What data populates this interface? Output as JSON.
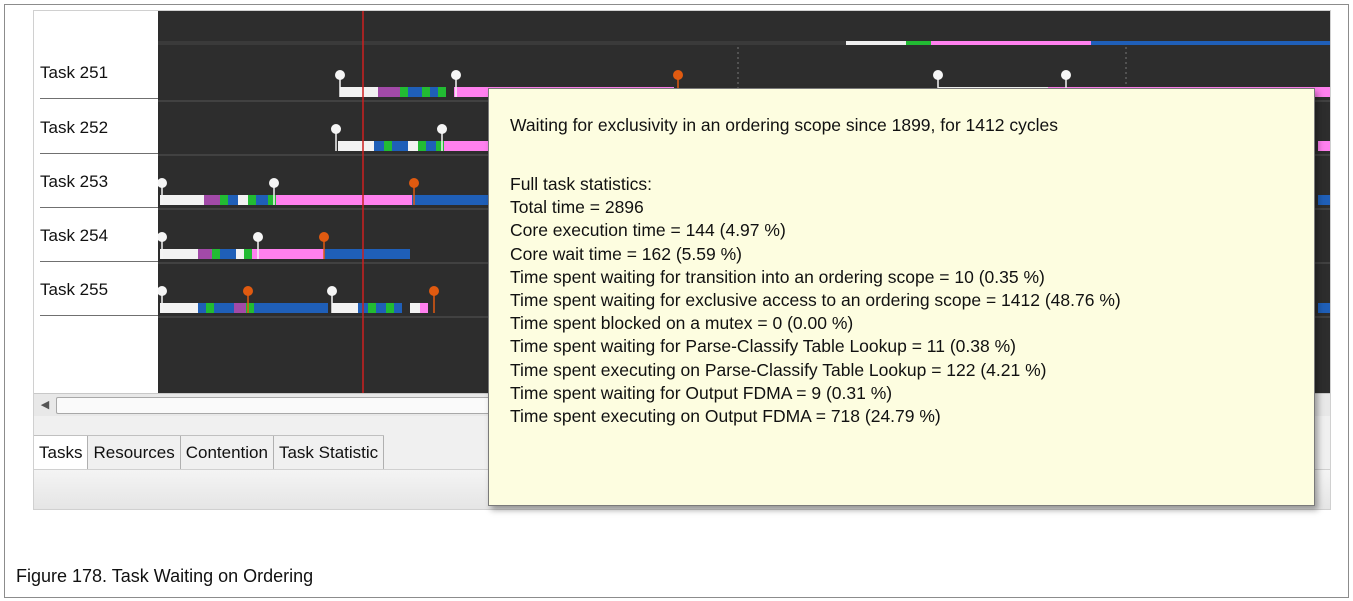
{
  "rows": [
    {
      "label": "Task 251"
    },
    {
      "label": "Task 252"
    },
    {
      "label": "Task 253"
    },
    {
      "label": "Task 254"
    },
    {
      "label": "Task 255"
    }
  ],
  "tabs": [
    "Tasks",
    "Resources",
    "Contention",
    "Task Statistic"
  ],
  "tooltip": {
    "header": "Waiting for exclusivity in an ordering scope since 1899, for 1412 cycles",
    "lines": [
      "Full task statistics:",
      "Total time = 2896",
      "Core execution time = 144 (4.97 %)",
      "Core wait time = 162 (5.59 %)",
      "Time spent waiting for transition into an ordering scope = 10 (0.35 %)",
      "Time spent waiting for exclusive access to an ordering scope = 1412 (48.76 %)",
      "Time spent blocked on a mutex = 0 (0.00 %)",
      "Time spent waiting for Parse-Classify Table Lookup = 11 (0.38 %)",
      "Time spent executing on Parse-Classify Table Lookup = 122 (4.21 %)",
      "Time spent waiting for Output FDMA = 9 (0.31 %)",
      "Time spent executing on Output FDMA = 718 (24.79 %)"
    ]
  },
  "caption": "Figure 178.  Task Waiting on Ordering",
  "colors": {
    "chart_bg": "#2d2d2d",
    "segment_white": "#f2f2f2",
    "segment_magenta": "#ff80ee",
    "segment_blue": "#1f5fb8",
    "segment_green": "#22bb33",
    "segment_purple": "#a24aa8",
    "marker_white": "#f5f5f5",
    "marker_orange": "#e05a10",
    "cursor_line": "#cc2020",
    "tooltip_bg": "#fdfde0"
  }
}
